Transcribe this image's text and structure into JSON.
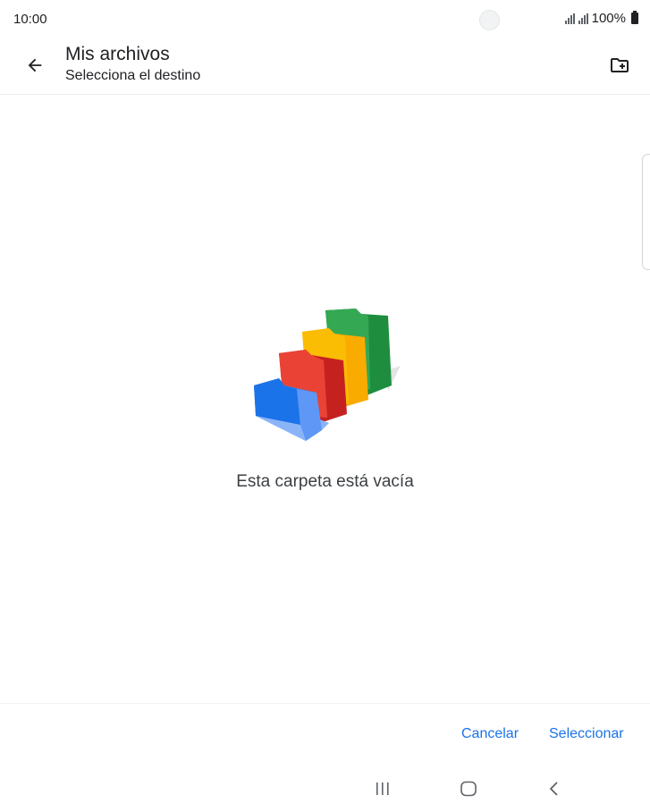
{
  "status_bar": {
    "time": "10:00",
    "battery_text": "100%",
    "icons": [
      "signal-icon",
      "signal-icon",
      "battery-icon"
    ]
  },
  "app_bar": {
    "title": "Mis archivos",
    "subtitle": "Selecciona el destino",
    "icons": {
      "back": "arrow-back-icon",
      "new_folder": "create-new-folder-icon"
    }
  },
  "empty_state": {
    "message": "Esta carpeta está vacía",
    "illustration": "empty-folders-illustration",
    "colors": {
      "blue": "#4285f4",
      "red": "#ea4335",
      "yellow": "#fbbc04",
      "green": "#34a853"
    }
  },
  "actions": {
    "cancel_label": "Cancelar",
    "select_label": "Seleccionar",
    "accent_color": "#1a73e8"
  },
  "nav_bar": {
    "icons": [
      "recents-icon",
      "home-icon",
      "back-icon"
    ]
  }
}
